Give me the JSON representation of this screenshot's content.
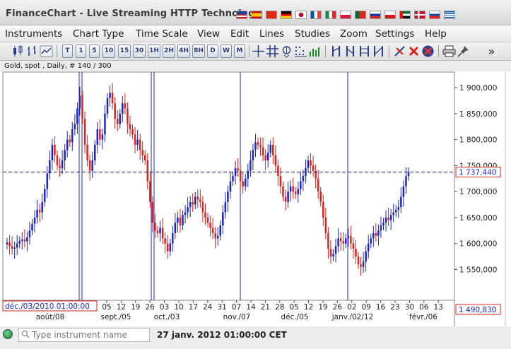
{
  "window": {
    "title": "FinanceChart - Live Streaming HTTP Technology"
  },
  "flags": [
    "us",
    "es",
    "cn",
    "de",
    "jp",
    "fr",
    "it",
    "pl",
    "pt",
    "ru",
    "cz",
    "ae",
    "dk",
    "sk",
    "gr"
  ],
  "menu": [
    "Instruments",
    "Chart Type",
    "Time Scale",
    "View",
    "Edit",
    "Lines",
    "Studies",
    "Zoom",
    "Settings",
    "Help"
  ],
  "toolbar": {
    "timeframes": [
      "T",
      "1",
      "5",
      "10",
      "15",
      "30",
      "1H",
      "2H",
      "4H",
      "8H",
      "D",
      "W",
      "M"
    ],
    "more_label": "»"
  },
  "info": {
    "label": "Gold, spot , Daily, # 140 / 300"
  },
  "chart_data": {
    "type": "candlestick",
    "y_ticks": [
      "1 900,000",
      "1 850,000",
      "1 800,000",
      "1 750,000",
      "1 700,000",
      "1 650,000",
      "1 600,000",
      "1 550,000"
    ],
    "ylim": [
      1490830,
      1930000
    ],
    "current_price": "1 737,440",
    "current_value": 1737440,
    "min_label": "1 490,830",
    "start_label": "déc./03/2010 01:00:00",
    "x_ticks": [
      "05",
      "12",
      "19",
      "26",
      "03",
      "10",
      "17",
      "24",
      "31",
      "07",
      "14",
      "21",
      "28",
      "05",
      "12",
      "19",
      "26",
      "02",
      "09",
      "16",
      "23",
      "30",
      "06",
      "13"
    ],
    "month_labels": [
      "août/08",
      "sept./05",
      "oct./03",
      "nov./07",
      "déc./05",
      "janv./02/12",
      "févr./06"
    ],
    "candle_colors": {
      "up": "#1a24cc",
      "down": "#e0201c"
    },
    "closes": [
      1602000,
      1595000,
      1590000,
      1592000,
      1600000,
      1605000,
      1608000,
      1604000,
      1612000,
      1625000,
      1638000,
      1650000,
      1665000,
      1660000,
      1680000,
      1705000,
      1735000,
      1760000,
      1790000,
      1770000,
      1750000,
      1745000,
      1760000,
      1780000,
      1800000,
      1795000,
      1820000,
      1830000,
      1860000,
      1885000,
      1840000,
      1790000,
      1760000,
      1740000,
      1760000,
      1790000,
      1820000,
      1800000,
      1810000,
      1850000,
      1880000,
      1890000,
      1870000,
      1840000,
      1830000,
      1850000,
      1870000,
      1860000,
      1830000,
      1820000,
      1810000,
      1790000,
      1800000,
      1780000,
      1770000,
      1760000,
      1720000,
      1680000,
      1640000,
      1625000,
      1620000,
      1630000,
      1610000,
      1600000,
      1585000,
      1600000,
      1620000,
      1640000,
      1650000,
      1635000,
      1655000,
      1660000,
      1670000,
      1680000,
      1675000,
      1690000,
      1685000,
      1680000,
      1660000,
      1650000,
      1640000,
      1630000,
      1620000,
      1610000,
      1615000,
      1635000,
      1660000,
      1680000,
      1700000,
      1720000,
      1730000,
      1745000,
      1740000,
      1720000,
      1710000,
      1725000,
      1740000,
      1760000,
      1780000,
      1795000,
      1790000,
      1785000,
      1770000,
      1760000,
      1775000,
      1790000,
      1770000,
      1750000,
      1730000,
      1710000,
      1690000,
      1680000,
      1700000,
      1710000,
      1700000,
      1695000,
      1705000,
      1720000,
      1730000,
      1745000,
      1760000,
      1750000,
      1740000,
      1725000,
      1700000,
      1680000,
      1650000,
      1620000,
      1590000,
      1575000,
      1580000,
      1595000,
      1610000,
      1605000,
      1600000,
      1610000,
      1615000,
      1600000,
      1590000,
      1575000,
      1560000,
      1555000,
      1565000,
      1585000,
      1600000,
      1610000,
      1620000,
      1615000,
      1625000,
      1635000,
      1640000,
      1650000,
      1645000,
      1655000,
      1660000,
      1665000,
      1670000,
      1690000,
      1710000,
      1730000,
      1737440
    ]
  },
  "status": {
    "instrument_placeholder": "Type instrument name",
    "timestamp": "27 janv. 2012 01:00:00 CET"
  }
}
